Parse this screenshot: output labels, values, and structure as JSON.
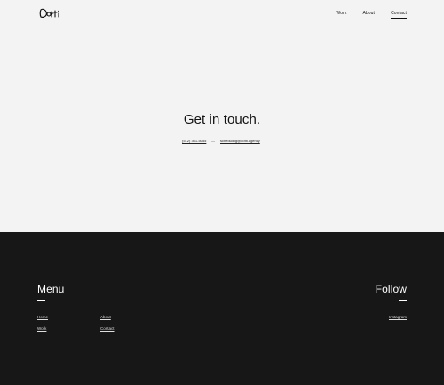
{
  "header": {
    "logo_text": "Dotti",
    "nav": [
      {
        "label": "Work",
        "active": false
      },
      {
        "label": "About",
        "active": false
      },
      {
        "label": "Contact",
        "active": true
      }
    ]
  },
  "hero": {
    "title": "Get in touch.",
    "phone": "(512) 361-5055",
    "separator": "—",
    "email": "scheduling@dotti.agency"
  },
  "footer": {
    "menu_heading": "Menu",
    "menu_links": {
      "home": "Home",
      "work": "Work",
      "about": "About",
      "contact": "Contact"
    },
    "follow_heading": "Follow",
    "social_links": {
      "instagram": "Instagram"
    }
  },
  "colors": {
    "background": "#f3f3f3",
    "footer_background": "#171717",
    "text": "#111111",
    "footer_text": "#ffffff"
  }
}
